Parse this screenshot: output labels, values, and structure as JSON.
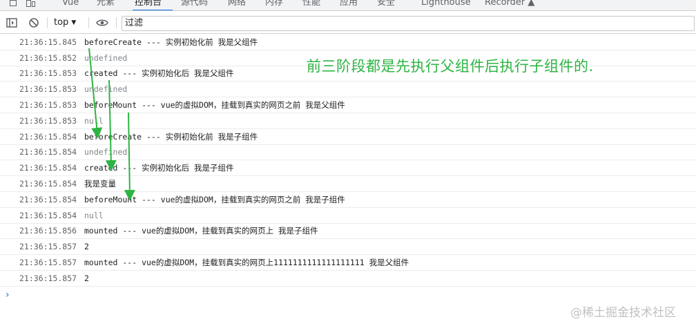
{
  "devtools": {
    "tabs": [
      "Vue",
      "元素",
      "控制台",
      "源代码",
      "网络",
      "内存",
      "性能",
      "应用",
      "安全",
      "Lighthouse",
      "Recorder ▲"
    ],
    "active_tab": "控制台"
  },
  "toolbar": {
    "context": "top",
    "context_arrow": "▼",
    "filter_placeholder": "过滤"
  },
  "log": [
    {
      "time": "21:36:15.845",
      "text": "beforeCreate --- 实例初始化前 我是父组件",
      "muted": false
    },
    {
      "time": "21:36:15.852",
      "text": "undefined",
      "muted": true
    },
    {
      "time": "21:36:15.853",
      "text": "created ---  实例初始化后 我是父组件",
      "muted": false
    },
    {
      "time": "21:36:15.853",
      "text": "undefined",
      "muted": true
    },
    {
      "time": "21:36:15.853",
      "text": "beforeMount --- vue的虚拟DOM，挂载到真实的网页之前 我是父组件",
      "muted": false
    },
    {
      "time": "21:36:15.853",
      "text": "null",
      "muted": true
    },
    {
      "time": "21:36:15.854",
      "text": "beforeCreate --- 实例初始化前 我是子组件",
      "muted": false
    },
    {
      "time": "21:36:15.854",
      "text": "undefined",
      "muted": true
    },
    {
      "time": "21:36:15.854",
      "text": "created ---  实例初始化后 我是子组件",
      "muted": false
    },
    {
      "time": "21:36:15.854",
      "text": "我是变量",
      "muted": false
    },
    {
      "time": "21:36:15.854",
      "text": "beforeMount --- vue的虚拟DOM，挂载到真实的网页之前 我是子组件",
      "muted": false
    },
    {
      "time": "21:36:15.854",
      "text": "null",
      "muted": true
    },
    {
      "time": "21:36:15.856",
      "text": "mounted --- vue的虚拟DOM，挂载到真实的网页上 我是子组件",
      "muted": false
    },
    {
      "time": "21:36:15.857",
      "text": "2",
      "muted": false
    },
    {
      "time": "21:36:15.857",
      "text": "mounted --- vue的虚拟DOM，挂载到真实的网页上1111111111111111111 我是父组件",
      "muted": false
    },
    {
      "time": "21:36:15.857",
      "text": "2",
      "muted": false
    }
  ],
  "prompt_symbol": "›",
  "annotation": "前三阶段都是先执行父组件后执行子组件的.",
  "watermark": "@稀土掘金技术社区",
  "colors": {
    "annotation": "#2db442",
    "accent": "#1a73e8",
    "arrow": "#2db442"
  }
}
